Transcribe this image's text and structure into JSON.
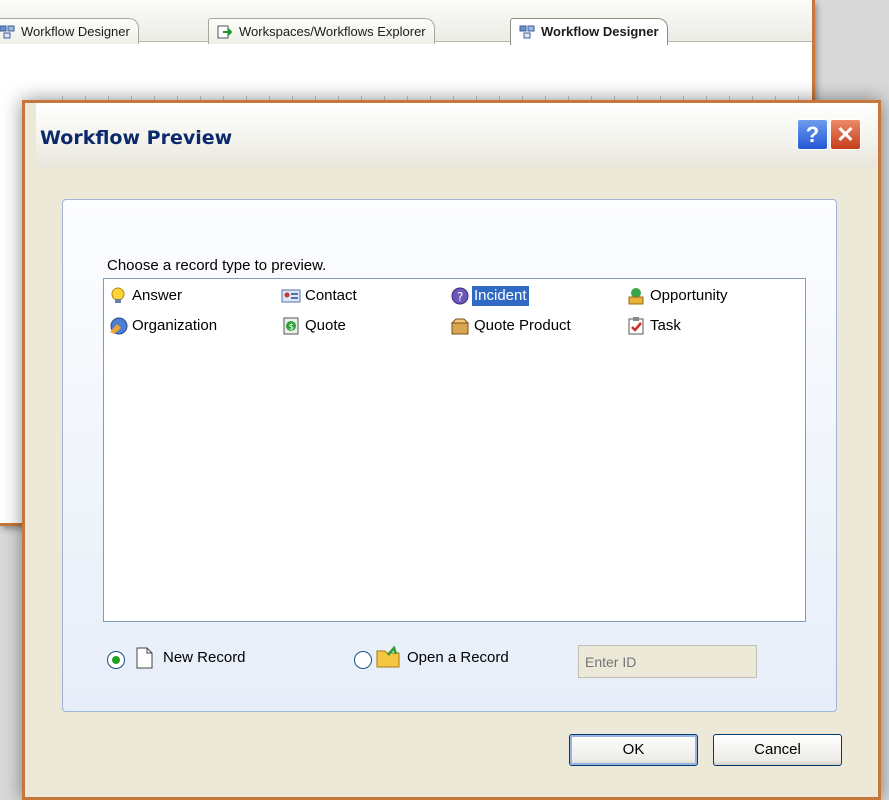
{
  "tabs": [
    {
      "label": "Workflow Designer",
      "icon": "workflow-icon"
    },
    {
      "label": "Workspaces/Workflows Explorer",
      "icon": "explorer-icon"
    },
    {
      "label": "Workflow Designer",
      "icon": "workflow-icon",
      "active": true
    }
  ],
  "dialog": {
    "title": "Workflow Preview",
    "help_label": "?",
    "close_label": "✕",
    "prompt": "Choose a record type to preview.",
    "record_types": [
      {
        "label": "Answer",
        "icon": "lightbulb-icon"
      },
      {
        "label": "Contact",
        "icon": "contact-card-icon"
      },
      {
        "label": "Incident",
        "icon": "incident-icon",
        "selected": true
      },
      {
        "label": "Opportunity",
        "icon": "opportunity-icon"
      },
      {
        "label": "Organization",
        "icon": "organization-icon"
      },
      {
        "label": "Quote",
        "icon": "quote-icon"
      },
      {
        "label": "Quote Product",
        "icon": "quote-product-icon"
      },
      {
        "label": "Task",
        "icon": "task-icon"
      }
    ],
    "options": {
      "new_record_label": "New Record",
      "open_record_label": "Open a Record",
      "selected": "new_record"
    },
    "id_input": {
      "placeholder": "Enter ID",
      "value": ""
    },
    "ok_label": "OK",
    "cancel_label": "Cancel"
  },
  "colors": {
    "accent_border": "#c8773a",
    "title_text": "#0b2a6b",
    "selection": "#316ac5",
    "radio_dot": "#21a121"
  }
}
